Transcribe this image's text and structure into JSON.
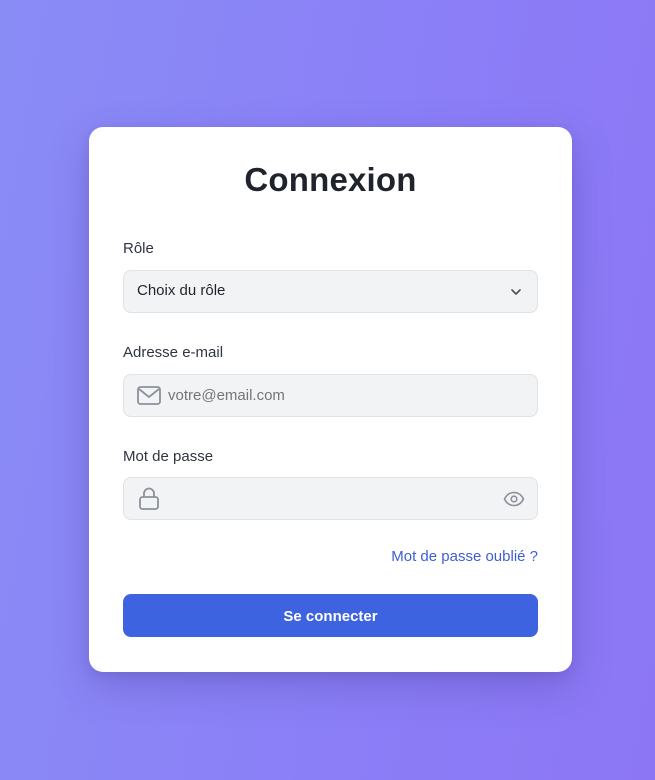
{
  "form": {
    "title": "Connexion",
    "role": {
      "label": "Rôle",
      "selected": "Choix du rôle",
      "icon": "chevron-down-icon"
    },
    "email": {
      "label": "Adresse e-mail",
      "placeholder": "votre@email.com",
      "value": "",
      "icon": "mail-icon"
    },
    "password": {
      "label": "Mot de passe",
      "placeholder": "",
      "value": "",
      "icon": "lock-icon",
      "toggle_icon": "eye-icon"
    },
    "forgot_link": "Mot de passe oublié ?",
    "submit_label": "Se connecter"
  },
  "colors": {
    "background_start": "#8a8cf6",
    "background_end": "#8c76f4",
    "card": "#ffffff",
    "accent": "#3d63e0",
    "link": "#3d5fd6",
    "field_bg": "#f2f3f5",
    "field_border": "#dfe2e6"
  }
}
